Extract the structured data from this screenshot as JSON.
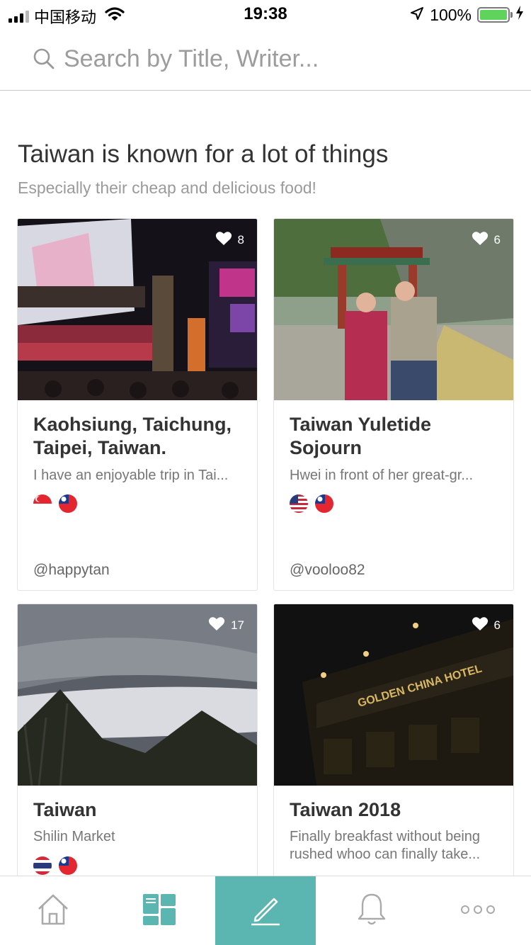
{
  "status_bar": {
    "carrier": "中国移动",
    "time": "19:38",
    "battery": "100%"
  },
  "search": {
    "placeholder": "Search by Title, Writer..."
  },
  "section": {
    "title": "Taiwan is known for a lot of things",
    "subtitle": "Especially their cheap and delicious food!"
  },
  "cards": [
    {
      "likes": "8",
      "title": "Kaohsiung, Taichung, Taipei, Taiwan.",
      "description": "I have an enjoyable trip in Tai...",
      "flags": [
        "singapore-flag-icon",
        "taiwan-flag-icon"
      ],
      "author": "@happytan"
    },
    {
      "likes": "6",
      "title": "Taiwan Yuletide Sojourn",
      "description": "Hwei in front of her great-gr...",
      "flags": [
        "usa-flag-icon",
        "taiwan-flag-icon"
      ],
      "author": "@vooloo82"
    },
    {
      "likes": "17",
      "title": "Taiwan",
      "description": "Shilin Market",
      "flags": [
        "thailand-flag-icon",
        "taiwan-flag-icon"
      ],
      "author": ""
    },
    {
      "likes": "6",
      "title": "Taiwan 2018",
      "description": "Finally breakfast without being rushed whoo can finally take...",
      "flags": [],
      "author": ""
    }
  ],
  "tab_bar": {
    "items": [
      "home-icon",
      "feed-icon",
      "write-icon",
      "bell-icon",
      "more-icon"
    ],
    "active_index": 2,
    "accent_color": "#5bb5b0"
  }
}
